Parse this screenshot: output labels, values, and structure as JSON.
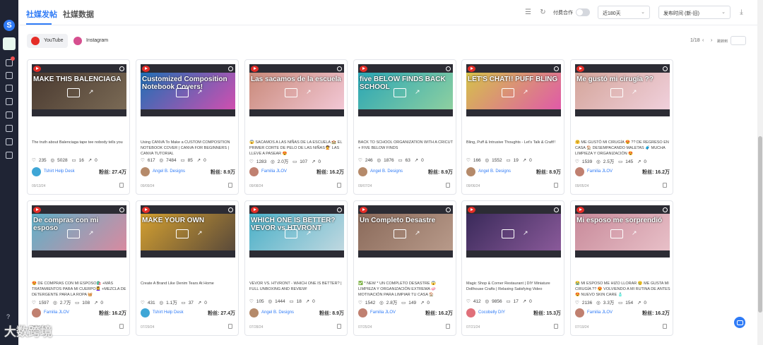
{
  "sidebar": {
    "logo_letter": "S"
  },
  "header": {
    "tabs": [
      "社媒发帖",
      "社媒数据"
    ],
    "toggle_label": "付费合作",
    "range_select": "近180天",
    "sort_select": "发布时间 (新-旧)"
  },
  "platforms": [
    "YouTube",
    "Instagram"
  ],
  "pager": {
    "text": "1/18",
    "goto": "跳转到"
  },
  "cards": [
    {
      "title": "MAKE THIS BALENCIAGA",
      "desc": "The truth about Balenciaga tape tee nobody tells you",
      "likes": "235",
      "views": "5028",
      "comments": "16",
      "shares": "0",
      "author": "Tshirt Help Desk",
      "fans": "粉丝: 27.4万",
      "date": "09/13/24",
      "c1": "#4a3a30",
      "c2": "#7a6a55",
      "av": "#3ea6d6"
    },
    {
      "title": "Customized Composition Notebook Covers!",
      "desc": "Using CANVA To Make a CUSTOM COMPOSITION NOTEBOOK COVER | CANVA FOR BEGINNERS | CANVA TUTORIAL",
      "likes": "617",
      "views": "7484",
      "comments": "85",
      "shares": "0",
      "author": "Angel B. Designs",
      "fans": "粉丝: 8.9万",
      "date": "09/09/24",
      "c1": "#1f6fb5",
      "c2": "#d04fb0",
      "av": "#b58a6a"
    },
    {
      "title": "Las sacamos de la escuela",
      "desc": "😱 SACAMOS A LAS NIÑAS DE LA ESCUELA 🏫 EL PRIMER CORTE DE PELO DE LAS NIÑAS 💇 LAS LLEVE A PASEAR 😍",
      "likes": "1283",
      "views": "2.0万",
      "comments": "107",
      "shares": "0",
      "author": "Familia JLOV",
      "fans": "粉丝: 16.2万",
      "date": "09/08/24",
      "c1": "#c98a7a",
      "c2": "#f2c7d5",
      "av": "#c08070"
    },
    {
      "title": "five BELOW FINDS BACK SCHOOL",
      "desc": "BACK TO SCHOOL ORGANIZATION WITH A CRICUT + FIVE BELOW FINDS",
      "likes": "246",
      "views": "1876",
      "comments": "63",
      "shares": "0",
      "author": "Angel B. Designs",
      "fans": "粉丝: 8.9万",
      "date": "09/07/24",
      "c1": "#2aa6b5",
      "c2": "#8ed0a0",
      "av": "#b58a6a"
    },
    {
      "title": "LET'S CHAT!! PUFF BLING",
      "desc": "Bling, Puff & Intrusive Thoughts - Let's Talk & Craft!!",
      "likes": "166",
      "views": "1552",
      "comments": "19",
      "shares": "0",
      "author": "Angel B. Designs",
      "fans": "粉丝: 8.9万",
      "date": "09/06/24",
      "c1": "#d5c24a",
      "c2": "#e05aa8",
      "av": "#b58a6a"
    },
    {
      "title": "Me gustó mi cirugía ??",
      "desc": "🤗 ME GUSTÓ MI CIRUGÍA 😍 ?? DE REGRESO EN CASA 🏠 DESEMPACANDO MALETAS 🧳 MUCHA LIMPIEZA Y ORGANIZACIÓN 😍",
      "likes": "1539",
      "views": "2.5万",
      "comments": "145",
      "shares": "0",
      "author": "Familia JLOV",
      "fans": "粉丝: 16.2万",
      "date": "09/05/24",
      "c1": "#d4a59a",
      "c2": "#f0d0dc",
      "av": "#c08070"
    },
    {
      "title": "De compras con mi esposo",
      "desc": "😍 DE COMPRAS CON MI ESPOSO🛍️ +MÁS TRATAMIENTOS PARA MI CUERPO💆‍♀️ +MEZCLA DE DETERGENTE PARA LA ROPA 🧺",
      "likes": "1597",
      "views": "2.7万",
      "comments": "108",
      "shares": "0",
      "author": "Familia JLOV",
      "fans": "粉丝: 16.2万",
      "date": "08/02/24",
      "c1": "#5fb0c8",
      "c2": "#d88aa0",
      "av": "#c08070"
    },
    {
      "title": "MAKE YOUR OWN",
      "desc": "Create A Brand Like Denim Tears At Home",
      "likes": "431",
      "views": "1.1万",
      "comments": "37",
      "shares": "0",
      "author": "Tshirt Help Desk",
      "fans": "粉丝: 27.4万",
      "date": "07/29/24",
      "c1": "#d4a030",
      "c2": "#5a4a3a",
      "av": "#3ea6d6"
    },
    {
      "title": "WHICH ONE IS BETTER? VEVOR vs HTVRONT",
      "desc": "VEVOR VS. HTVRONT - WHICH ONE IS BETTER? | FULL UNBOXING AND REVIEW!",
      "likes": "105",
      "views": "1444",
      "comments": "18",
      "shares": "0",
      "author": "Angel B. Designs",
      "fans": "粉丝: 8.9万",
      "date": "07/28/24",
      "c1": "#4ab0c8",
      "c2": "#c0d8e0",
      "av": "#b58a6a"
    },
    {
      "title": "Un Completo Desastre",
      "desc": "✅ * NEW * UN COMPLETO DESASTRE 😱 LIMPIEZA Y ORGANIZACIÓN EXTREMA 🧼 MOTIVACIÓN PARA LIMPIAR TU CASA 🏠",
      "likes": "1542",
      "views": "2.8万",
      "comments": "149",
      "shares": "0",
      "author": "Familia JLOV",
      "fans": "粉丝: 16.2万",
      "date": "07/25/24",
      "c1": "#8a6a5a",
      "c2": "#b89a8a",
      "av": "#c08070"
    },
    {
      "title": "",
      "desc": "Magic Shop & Corner Restaurant | DIY Miniature Dollhouse Crafts | Relaxing Satisfying Video",
      "likes": "412",
      "views": "9856",
      "comments": "17",
      "shares": "0",
      "author": "Cocobelly DIY",
      "fans": "粉丝: 15.3万",
      "date": "07/21/24",
      "c1": "#3a2a5a",
      "c2": "#8a5a9a",
      "av": "#e0707a"
    },
    {
      "title": "Mi esposo me sorprendió",
      "desc": "😭 MI ESPOSO ME HIZO LLORAR 😢 ME GUSTA MI CIRUGÍA ?? 😍 VOLVIENDO A MI RUTINA DE ANTES 😍 NUEVO SKIN CARE 🧴",
      "likes": "2136",
      "views": "3.3万",
      "comments": "154",
      "shares": "0",
      "author": "Familia JLOV",
      "fans": "粉丝: 16.2万",
      "date": "07/19/24",
      "c1": "#c88a9a",
      "c2": "#e8c0c8",
      "av": "#c08070"
    }
  ],
  "watermark": "大数跨境"
}
